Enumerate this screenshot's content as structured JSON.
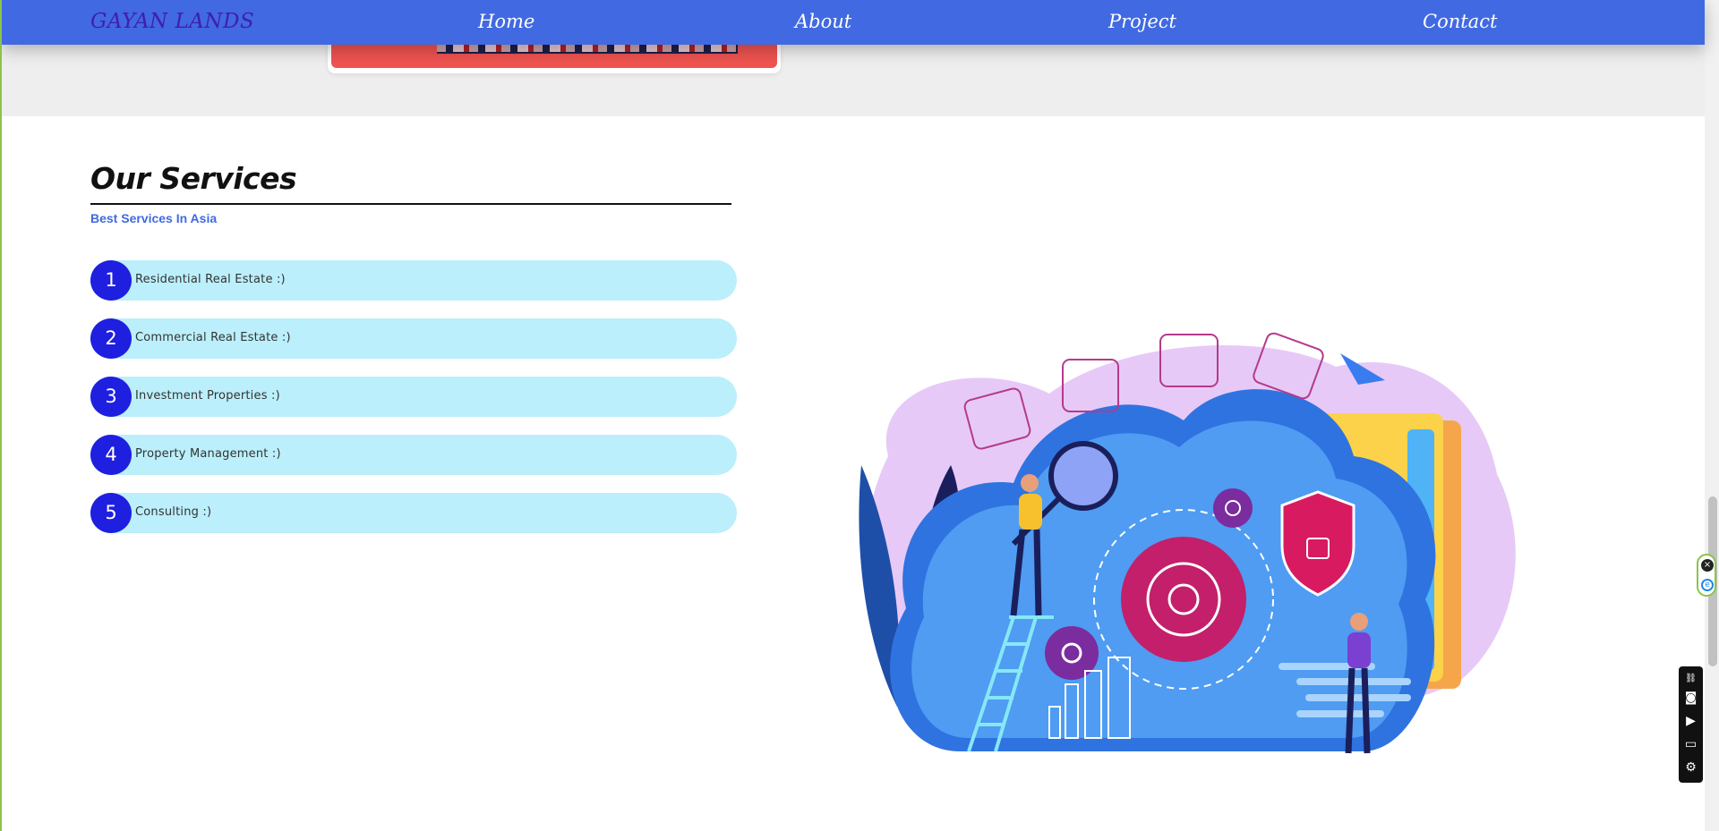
{
  "navbar": {
    "brand": "GAYAN LANDS",
    "links": [
      "Home",
      "About",
      "Project",
      "Contact"
    ]
  },
  "services": {
    "title": "Our Services",
    "subtitle": "Best Services In Asia",
    "items": [
      {
        "number": "1",
        "label": "Residential Real Estate :)"
      },
      {
        "number": "2",
        "label": "Commercial Real Estate :)"
      },
      {
        "number": "3",
        "label": "Investment Properties :)"
      },
      {
        "number": "4",
        "label": "Property Management :)"
      },
      {
        "number": "5",
        "label": "Consulting :)"
      }
    ]
  },
  "colors": {
    "navbar": "#4169e1",
    "brand": "#3f1db3",
    "row_bg": "#bbeffb",
    "badge": "#1f1fe0",
    "subtitle": "#4169e1"
  },
  "icons": {
    "ext_close": "close-icon",
    "ext_e": "e-icon",
    "toolbox": [
      "link-icon",
      "camera-icon",
      "video-icon",
      "window-icon",
      "gear-icon"
    ]
  }
}
